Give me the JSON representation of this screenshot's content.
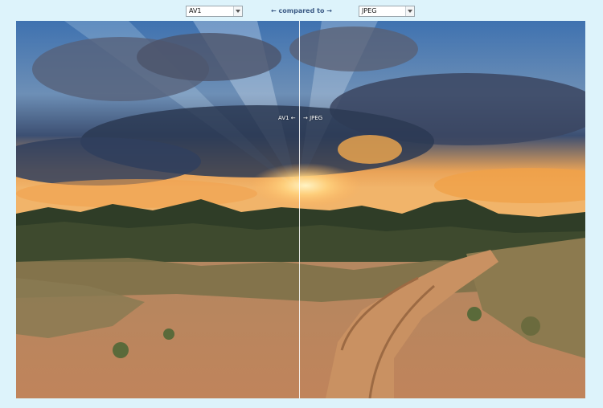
{
  "toolbar": {
    "left_select": {
      "value": "AV1"
    },
    "compared_label": "← compared to →",
    "right_select": {
      "value": "JPEG"
    }
  },
  "viewer": {
    "left_overlay": "AV1 ←",
    "right_overlay": "→ JPEG"
  },
  "icons": {
    "dropdown": "chevron-down-icon"
  }
}
